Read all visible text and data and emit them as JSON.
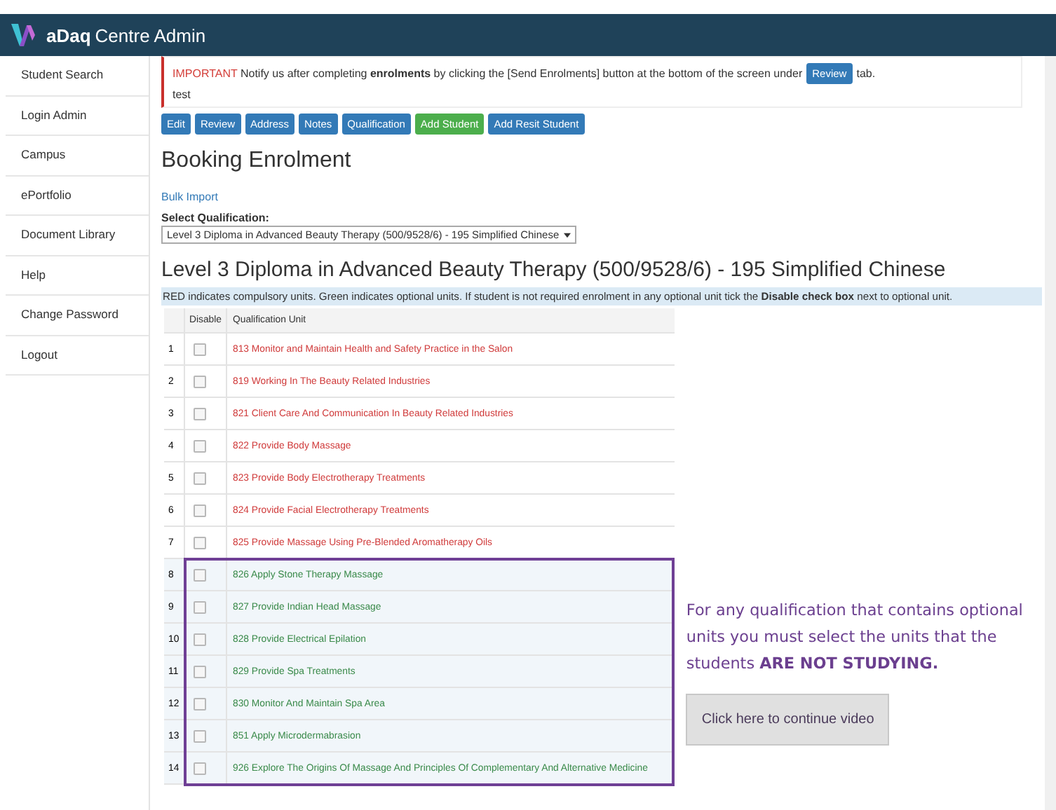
{
  "header": {
    "logo_text": "aDaq",
    "title": "Centre Admin"
  },
  "sidebar": {
    "items": [
      {
        "label": "Student Search"
      },
      {
        "label": "Login Admin"
      },
      {
        "label": "Campus"
      },
      {
        "label": "ePortfolio"
      },
      {
        "label": "Document Library"
      },
      {
        "label": "Help"
      },
      {
        "label": "Change Password"
      },
      {
        "label": "Logout"
      }
    ]
  },
  "notice": {
    "important": "IMPORTANT",
    "text_before": "Notify us after completing **enrolments** by clicking the [Send Enrolments] button at the bottom of the screen under",
    "button": "Review",
    "text_after": "tab.",
    "note": "test"
  },
  "toolbar": [
    {
      "label": "Edit",
      "kind": "primary"
    },
    {
      "label": "Review",
      "kind": "primary"
    },
    {
      "label": "Address",
      "kind": "primary"
    },
    {
      "label": "Notes",
      "kind": "primary"
    },
    {
      "label": "Qualification",
      "kind": "primary"
    },
    {
      "label": "Add Student",
      "kind": "success"
    },
    {
      "label": "Add Resit Student",
      "kind": "primary"
    }
  ],
  "booking": {
    "title": "Booking Enrolment",
    "bulk_import": "Bulk Import",
    "select_label": "Select Qualification:",
    "select_value": "Level 3 Diploma in Advanced Beauty Therapy (500/9528/6) - 195 Simplified Chinese",
    "qualification_title": "Level 3 Diploma in Advanced Beauty Therapy (500/9528/6) - 195 Simplified Chinese",
    "info": "RED indicates compulsory units. Green indicates optional units. If student is not required enrolment in any optional unit tick the **Disable check box** next to optional unit."
  },
  "table": {
    "columns": [
      "Disable",
      "Qualification Unit"
    ],
    "rows": [
      {
        "number": "1",
        "unit": "813 Monitor and Maintain Health and Safety Practice in the Salon",
        "kind": "compulsory",
        "checked": false
      },
      {
        "number": "2",
        "unit": "819 Working In The Beauty Related Industries",
        "kind": "compulsory",
        "checked": false
      },
      {
        "number": "3",
        "unit": "821 Client Care And Communication In Beauty Related Industries",
        "kind": "compulsory",
        "checked": false
      },
      {
        "number": "4",
        "unit": "822 Provide Body Massage",
        "kind": "compulsory",
        "checked": false
      },
      {
        "number": "5",
        "unit": "823 Provide Body Electrotherapy Treatments",
        "kind": "compulsory",
        "checked": false
      },
      {
        "number": "6",
        "unit": "824 Provide Facial Electrotherapy Treatments",
        "kind": "compulsory",
        "checked": false
      },
      {
        "number": "7",
        "unit": "825 Provide Massage Using Pre-Blended Aromatherapy Oils",
        "kind": "compulsory",
        "checked": false
      },
      {
        "number": "8",
        "unit": "826 Apply Stone Therapy Massage",
        "kind": "optional",
        "checked": false
      },
      {
        "number": "9",
        "unit": "827 Provide Indian Head Massage",
        "kind": "optional",
        "checked": false
      },
      {
        "number": "10",
        "unit": "828 Provide Electrical Epilation",
        "kind": "optional",
        "checked": false
      },
      {
        "number": "11",
        "unit": "829 Provide Spa Treatments",
        "kind": "optional",
        "checked": false
      },
      {
        "number": "12",
        "unit": "830 Monitor And Maintain Spa Area",
        "kind": "optional",
        "checked": false
      },
      {
        "number": "13",
        "unit": "851 Apply Microdermabrasion",
        "kind": "optional",
        "checked": false
      },
      {
        "number": "14",
        "unit": "926 Explore The Origins Of Massage And Principles Of Complementary And Alternative Medicine",
        "kind": "optional",
        "checked": false
      }
    ]
  },
  "callout": {
    "text": "For any qualification that contains optional units you must select the units that the students **ARE NOT STUDYING.**",
    "button": "Click here to continue video"
  }
}
